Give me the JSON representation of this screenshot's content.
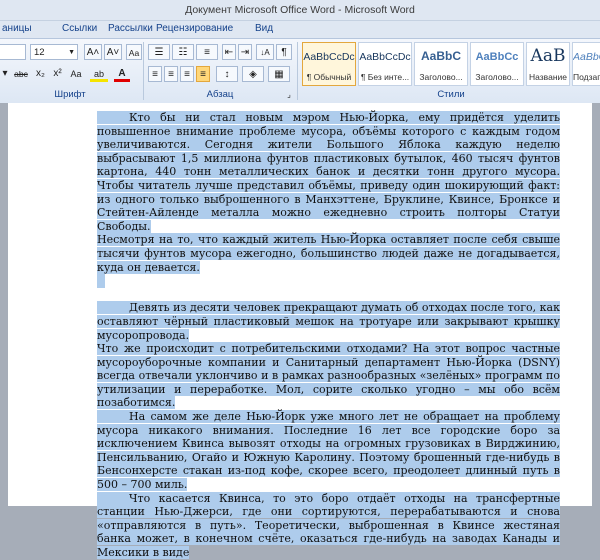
{
  "window": {
    "title": "Документ Microsoft Office Word - Microsoft Word"
  },
  "tabs": [
    "аницы",
    "Ссылки",
    "Рассылки",
    "Рецензирование",
    "Вид"
  ],
  "ribbon": {
    "font_group_label": "Шрифт",
    "paragraph_group_label": "Абзац",
    "styles_group_label": "Стили",
    "font_size": "12",
    "grow_font": "A˄",
    "shrink_font": "A˅",
    "clear_format": "Aa",
    "strike": "abc",
    "subscript": "x₂",
    "superscript": "x²",
    "change_case": "Aa",
    "highlight_letters": "ab",
    "font_color_letter": "A",
    "pilcrow": "¶",
    "sort": "↓A",
    "styles": [
      {
        "sample": "AaBbCcDc",
        "name": "¶ Обычный"
      },
      {
        "sample": "AaBbCcDc",
        "name": "¶ Без инте..."
      },
      {
        "sample": "AaBbC",
        "name": "Заголово..."
      },
      {
        "sample": "AaBbCc",
        "name": "Заголово..."
      },
      {
        "sample": "AaB",
        "name": "Название"
      },
      {
        "sample": "AaBbC",
        "name": "Подзаго..."
      }
    ]
  },
  "document": {
    "p1": "Кто бы ни стал новым мэром Нью-Йорка, ему придётся уделить повышенное внимание проблеме мусора, объёмы которого с каждым годом увеличиваются. Сегодня жители Большого Яблока каждую неделю выбрасывают 1,5 миллиона фунтов пластиковых бутылок, 460 тысяч фунтов картона, 440 тонн металлических банок и десятки тонн другого мусора. Чтобы читатель лучше представил объёмы, приведу один шокирующий факт: из одного только выброшенного в Манхэттене, Бруклине, Квинсе, Бронксе и Стейтен-Айленде металла можно ежедневно строить полторы Статуи Свободы.",
    "p2": "Несмотря на то, что каждый житель Нью-Йорка оставляет после себя свыше тысячи фунтов мусора ежегодно, большинство людей даже не догадывается, куда он девается.",
    "p3": "Девять из десяти человек прекращают думать об отходах после того, как оставляют чёрный пластиковый мешок на тротуаре или закрывают крышку мусоропровода.",
    "p4": "Что же происходит с потребительскими отходами? На этот вопрос частные мусороуборочные компании и Санитарный департамент Нью-Йорка (DSNY) всегда отвечали уклончиво и в рамках разнообразных «зелёных» программ по утилизации и переработке. Мол, сорите сколько угодно – мы обо всём позаботимся.",
    "p5": "На самом же деле Нью-Йорк уже много лет не обращает на проблему мусора никакого внимания. Последние 16 лет все городские боро за исключением Квинса вывозят отходы на огромных грузовиках в Вирджинию, Пенсильванию, Огайо и Южную Каролину. Поэтому брошенный где-нибудь в Бенсонхерсте стакан из-под кофе, скорее всего, преодолеет длинный путь в 500 – 700 миль.",
    "p6": "Что касается Квинса, то это боро отдаёт отходы на трансфертные станции Нью-Джерси, где они сортируются, перерабатываются и снова «отправляются в путь». Теоретически, выброшенная в Квинсе жестяная банка может, в конечном счёте, оказаться где-нибудь на заводах Канады и Мексики в виде"
  }
}
